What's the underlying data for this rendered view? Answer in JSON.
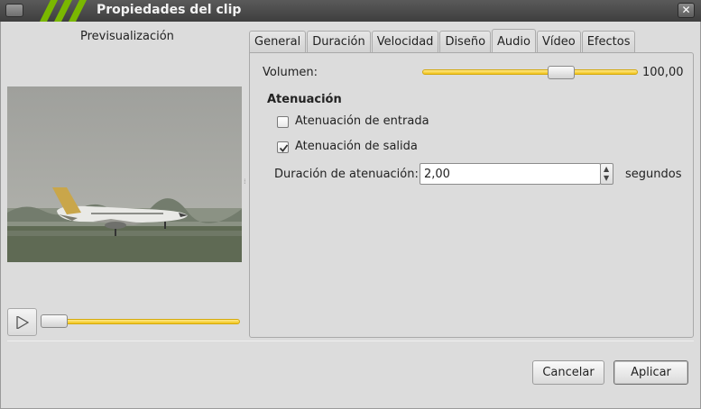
{
  "window": {
    "title": "Propiedades del clip"
  },
  "preview": {
    "label": "Previsualización",
    "progress": 0.0
  },
  "tabs": [
    {
      "label": "General",
      "active": false
    },
    {
      "label": "Duración",
      "active": false
    },
    {
      "label": "Velocidad",
      "active": false
    },
    {
      "label": "Diseño",
      "active": false
    },
    {
      "label": "Audio",
      "active": true
    },
    {
      "label": "Vídeo",
      "active": false
    },
    {
      "label": "Efectos",
      "active": false
    }
  ],
  "audio": {
    "volume_label": "Volumen:",
    "volume_value": "100,00",
    "volume_fraction": 0.6,
    "fade_heading": "Atenuación",
    "fade_in": {
      "label": "Atenuación de entrada",
      "checked": false
    },
    "fade_out": {
      "label": "Atenuación de salida",
      "checked": true
    },
    "fade_duration_label": "Duración de atenuación:",
    "fade_duration_value": "2,00",
    "fade_duration_unit": "segundos"
  },
  "buttons": {
    "cancel": "Cancelar",
    "apply": "Aplicar"
  },
  "colors": {
    "slider_fill": "#f0c419",
    "titlebar": "#3e3e3e",
    "stripes": "#7ab800"
  }
}
